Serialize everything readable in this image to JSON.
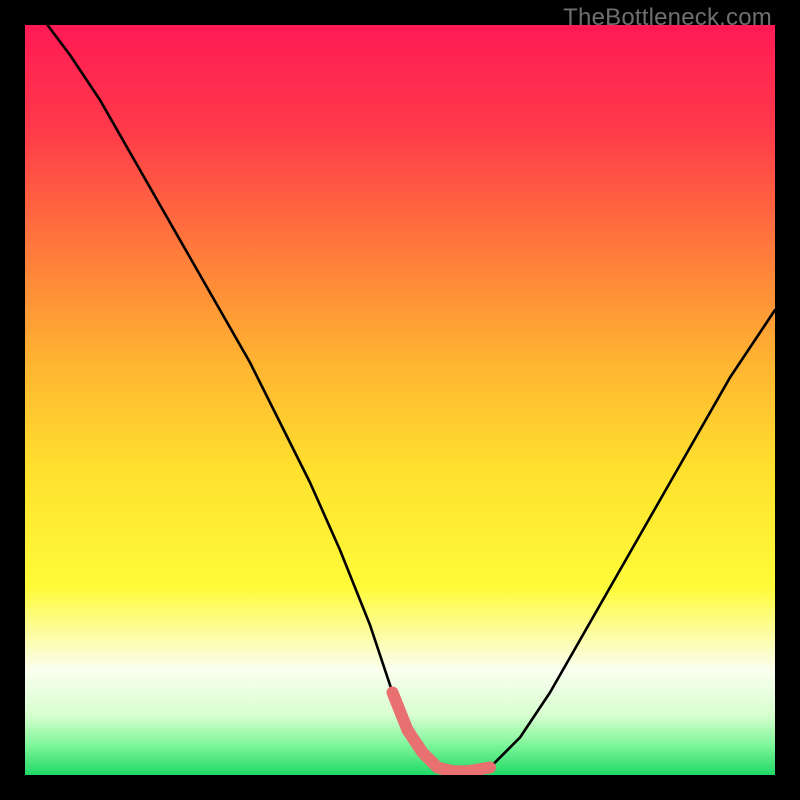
{
  "watermark": "TheBottleneck.com",
  "colors": {
    "gradient_stops": [
      {
        "pos": 0.0,
        "color": "#ff1a55"
      },
      {
        "pos": 0.14,
        "color": "#ff3a4a"
      },
      {
        "pos": 0.3,
        "color": "#ff7a3b"
      },
      {
        "pos": 0.45,
        "color": "#ffb431"
      },
      {
        "pos": 0.6,
        "color": "#ffe22e"
      },
      {
        "pos": 0.75,
        "color": "#fffb3a"
      },
      {
        "pos": 0.86,
        "color": "#fafff0"
      },
      {
        "pos": 0.92,
        "color": "#d8ffd0"
      },
      {
        "pos": 0.96,
        "color": "#7ef59a"
      },
      {
        "pos": 1.0,
        "color": "#1fd966"
      }
    ],
    "curve": "#000000",
    "highlight": "#e87070",
    "watermark": "#6f6f6f"
  },
  "chart_data": {
    "type": "line",
    "title": "",
    "xlabel": "",
    "ylabel": "",
    "xlim": [
      0,
      100
    ],
    "ylim": [
      0,
      100
    ],
    "grid": false,
    "series": [
      {
        "name": "curve",
        "x": [
          3,
          6,
          10,
          14,
          18,
          22,
          26,
          30,
          34,
          38,
          42,
          46,
          49,
          51,
          53,
          55,
          57,
          59,
          62,
          66,
          70,
          74,
          78,
          82,
          86,
          90,
          94,
          98,
          100
        ],
        "y": [
          100,
          96,
          90,
          83,
          76,
          69,
          62,
          55,
          47,
          39,
          30,
          20,
          11,
          6,
          3,
          1,
          0.5,
          0.5,
          1,
          5,
          11,
          18,
          25,
          32,
          39,
          46,
          53,
          59,
          62
        ]
      },
      {
        "name": "highlight-segment",
        "x": [
          49,
          51,
          53,
          55,
          57,
          59,
          62
        ],
        "y": [
          11,
          6,
          3,
          1,
          0.5,
          0.5,
          1
        ]
      }
    ],
    "annotations": []
  }
}
